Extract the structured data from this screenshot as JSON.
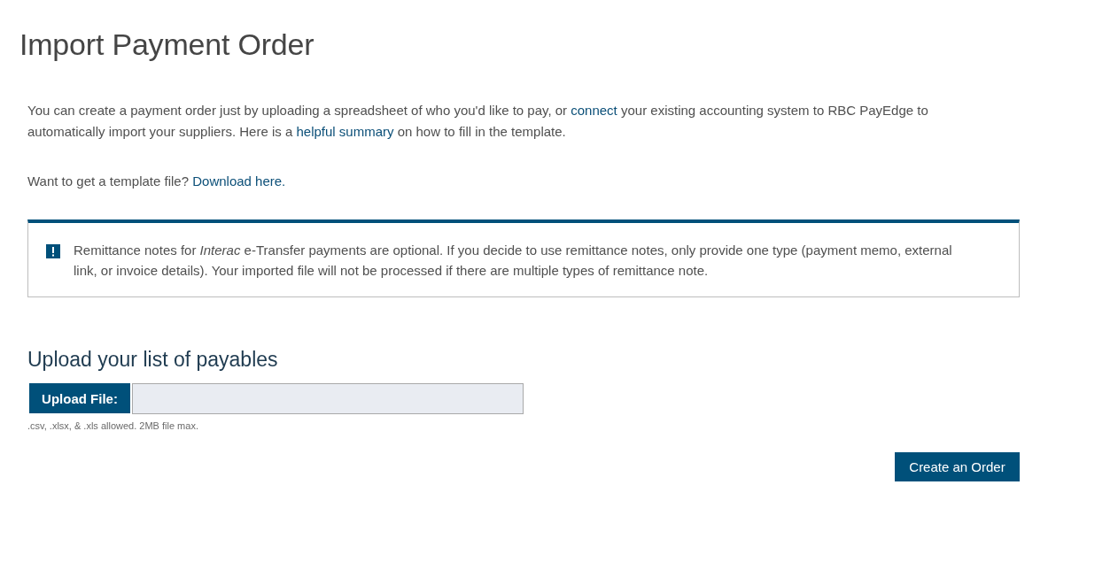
{
  "page": {
    "title": "Import Payment Order"
  },
  "intro": {
    "segments": [
      {
        "kind": "text",
        "text": "You can create a payment order just by uploading a spreadsheet of who you'd like to pay, or "
      },
      {
        "kind": "link",
        "text": "connect"
      },
      {
        "kind": "text",
        "text": " your existing accounting system to RBC PayEdge to automatically import your suppliers. Here is a "
      },
      {
        "kind": "link",
        "text": "helpful summary"
      },
      {
        "kind": "text",
        "text": " on how to fill in the template."
      }
    ]
  },
  "template_prompt": {
    "segments": [
      {
        "kind": "text",
        "text": "Want to get a template file? "
      },
      {
        "kind": "link",
        "text": "Download here."
      }
    ]
  },
  "notice": {
    "text": "Remittance notes for *Interac* e-Transfer payments are optional. If you decide to use remittance notes, only provide one type (payment memo, external link, or invoice details). Your imported file will not be processed if there are multiple types of remittance note."
  },
  "upload": {
    "heading": "Upload your list of payables",
    "button": "Upload File:",
    "hint": ".csv, .xlsx, & .xls allowed. 2MB file max."
  },
  "actions": {
    "create_button": "Create an Order"
  }
}
